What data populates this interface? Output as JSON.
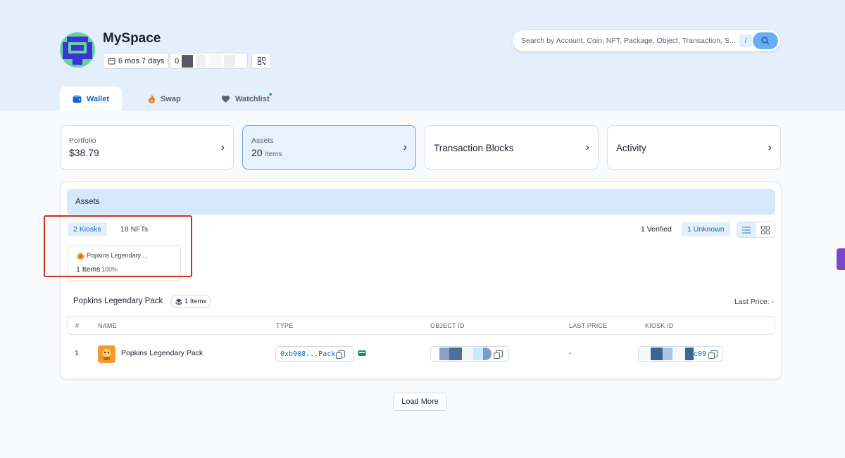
{
  "header": {
    "title": "MySpace",
    "age_chip": "6 mos 7 days",
    "address_prefix": "0",
    "search_placeholder": "Search by Account, Coin, NFT, Package, Object, Transaction, S...",
    "search_shortcut": "/"
  },
  "tabs": [
    {
      "label": "Wallet",
      "icon": "wallet-icon"
    },
    {
      "label": "Swap",
      "icon": "fire-icon"
    },
    {
      "label": "Watchlist",
      "icon": "heart-icon"
    }
  ],
  "summary_cards": {
    "portfolio": {
      "label": "Portfolio",
      "value": "$38.79"
    },
    "assets": {
      "label": "Assets",
      "value": "20",
      "unit": "items"
    },
    "transactions": {
      "label": "Transaction Blocks"
    },
    "activity": {
      "label": "Activity"
    }
  },
  "assets_panel": {
    "title": "Assets",
    "subtabs": [
      "2 Kiosks",
      "18 NFTs"
    ],
    "filters": {
      "verified": "1 Verified",
      "unknown": "1 Unknown"
    },
    "kiosk_card": {
      "name": "Popkins Legendary ...",
      "items": "1 Items",
      "percent": "100%"
    },
    "group": {
      "title": "Popkins Legendary Pack",
      "count": "1 Items",
      "last_price": "Last Price: -"
    },
    "table": {
      "headers": [
        "#",
        "NAME",
        "TYPE",
        "OBJECT ID",
        "LAST PRICE",
        "KIOSK ID"
      ],
      "rows": [
        {
          "index": "1",
          "name": "Popkins Legendary Pack",
          "type": "0xb908...Pack",
          "last_price": "-",
          "kiosk_suffix": "c09"
        }
      ]
    },
    "load_more": "Load More"
  },
  "colors": {
    "accent": "#1b63c6",
    "header_bg": "#e4effc",
    "highlight": "#d62b1f"
  }
}
